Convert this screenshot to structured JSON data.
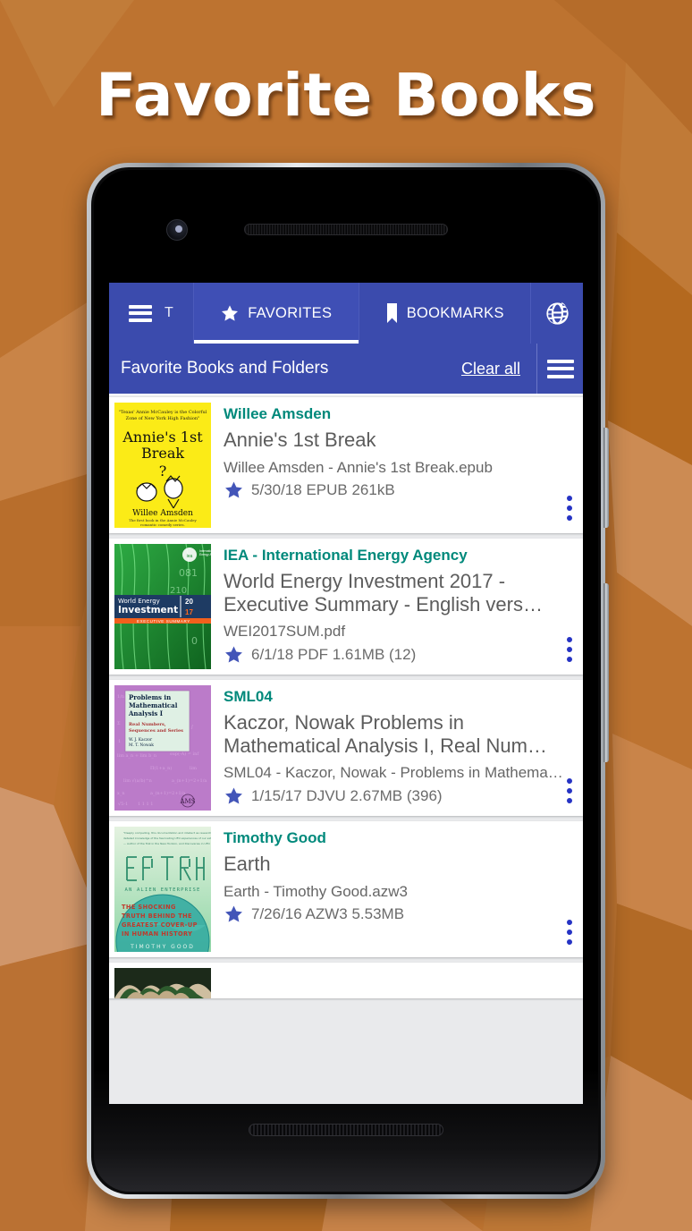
{
  "promo": {
    "title": "Favorite Books",
    "background_color": "#BD7330",
    "title_color": "#FFFFFF"
  },
  "theme": {
    "primary_blue": "#3B4BAD",
    "author_green": "#00897B",
    "star_blue": "#4355B8",
    "overflow_dot_blue": "#2633C4",
    "list_background": "#E9EAEC",
    "card_background": "#FFFFFF"
  },
  "app": {
    "tabs": [
      {
        "label": "T",
        "icon": "hamburger-menu-icon",
        "name": "menu-tab",
        "active": false
      },
      {
        "label": "FAVORITES",
        "icon": "star-icon",
        "name": "favorites-tab",
        "active": true
      },
      {
        "label": "BOOKMARKS",
        "icon": "bookmark-icon",
        "name": "bookmarks-tab",
        "active": false
      },
      {
        "label": "",
        "icon": "globe-icon",
        "name": "web-tab",
        "active": false
      }
    ],
    "subheader": {
      "title": "Favorite Books and Folders",
      "clear_all_label": "Clear all",
      "menu_icon": "hamburger-menu-icon"
    },
    "books": [
      {
        "author": "Willee Amsden",
        "title": "Annie's 1st Break",
        "filename": "Willee Amsden -  Annie's 1st Break.epub",
        "date": "5/30/18",
        "format": "EPUB",
        "size": "261kB",
        "pages": "",
        "meta": "5/30/18  EPUB  261kB",
        "cover_id": "annies-1st-break-cover"
      },
      {
        "author": "IEA - International Energy Agency",
        "title": "World Energy Investment 2017 - Executive Summary - English vers…",
        "filename": "WEI2017SUM.pdf",
        "date": "6/1/18",
        "format": "PDF",
        "size": "1.61MB",
        "pages": "(12)",
        "meta": "6/1/18  PDF  1.61MB (12)",
        "cover_id": "world-energy-investment-cover"
      },
      {
        "author": "SML04",
        "title": "Kaczor, Nowak  Problems in Mathematical Analysis I, Real Num…",
        "filename": "SML04 - Kaczor, Nowak - Problems in Mathema…",
        "date": "1/15/17",
        "format": "DJVU",
        "size": "2.67MB",
        "pages": "(396)",
        "meta": "1/15/17  DJVU  2.67MB (396)",
        "cover_id": "problems-math-analysis-cover"
      },
      {
        "author": "Timothy Good",
        "title": "Earth",
        "filename": "Earth - Timothy Good.azw3",
        "date": "7/26/16",
        "format": "AZW3",
        "size": "5.53MB",
        "pages": "",
        "meta": "7/26/16  AZW3  5.53MB",
        "cover_id": "earth-alien-enterprise-cover"
      }
    ]
  },
  "device": {
    "front_camera": "front-camera-icon",
    "earpiece": "earpiece-speaker",
    "bottom_speaker": "bottom-speaker",
    "volume_button": "volume-rocker-button",
    "power_button": "power-button"
  }
}
